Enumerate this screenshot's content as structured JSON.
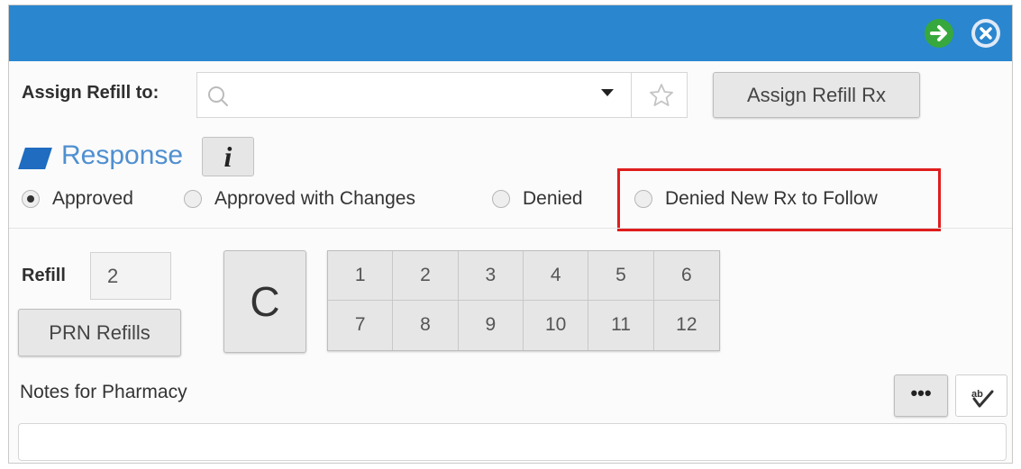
{
  "titlebar": {
    "icons": [
      "arrow-right-icon",
      "close-icon"
    ],
    "colors": {
      "bar": "#2a86cf",
      "next": "#37a83d"
    }
  },
  "assign": {
    "label": "Assign Refill to:",
    "search_value": "",
    "search_placeholder": "",
    "button_label": "Assign Refill Rx"
  },
  "response": {
    "title": "Response",
    "info_label": "i",
    "options": [
      {
        "label": "Approved",
        "selected": true
      },
      {
        "label": "Approved with Changes",
        "selected": false
      },
      {
        "label": "Denied",
        "selected": false
      },
      {
        "label": "Denied New Rx to Follow",
        "selected": false
      }
    ],
    "highlight_color": "#e01d1d"
  },
  "refill": {
    "label": "Refill",
    "value": "2",
    "prn_label": "PRN Refills",
    "clear_label": "C",
    "numbers": [
      "1",
      "2",
      "3",
      "4",
      "5",
      "6",
      "7",
      "8",
      "9",
      "10",
      "11",
      "12"
    ]
  },
  "notes": {
    "label": "Notes for Pharmacy",
    "more_label": "•••",
    "value": ""
  }
}
